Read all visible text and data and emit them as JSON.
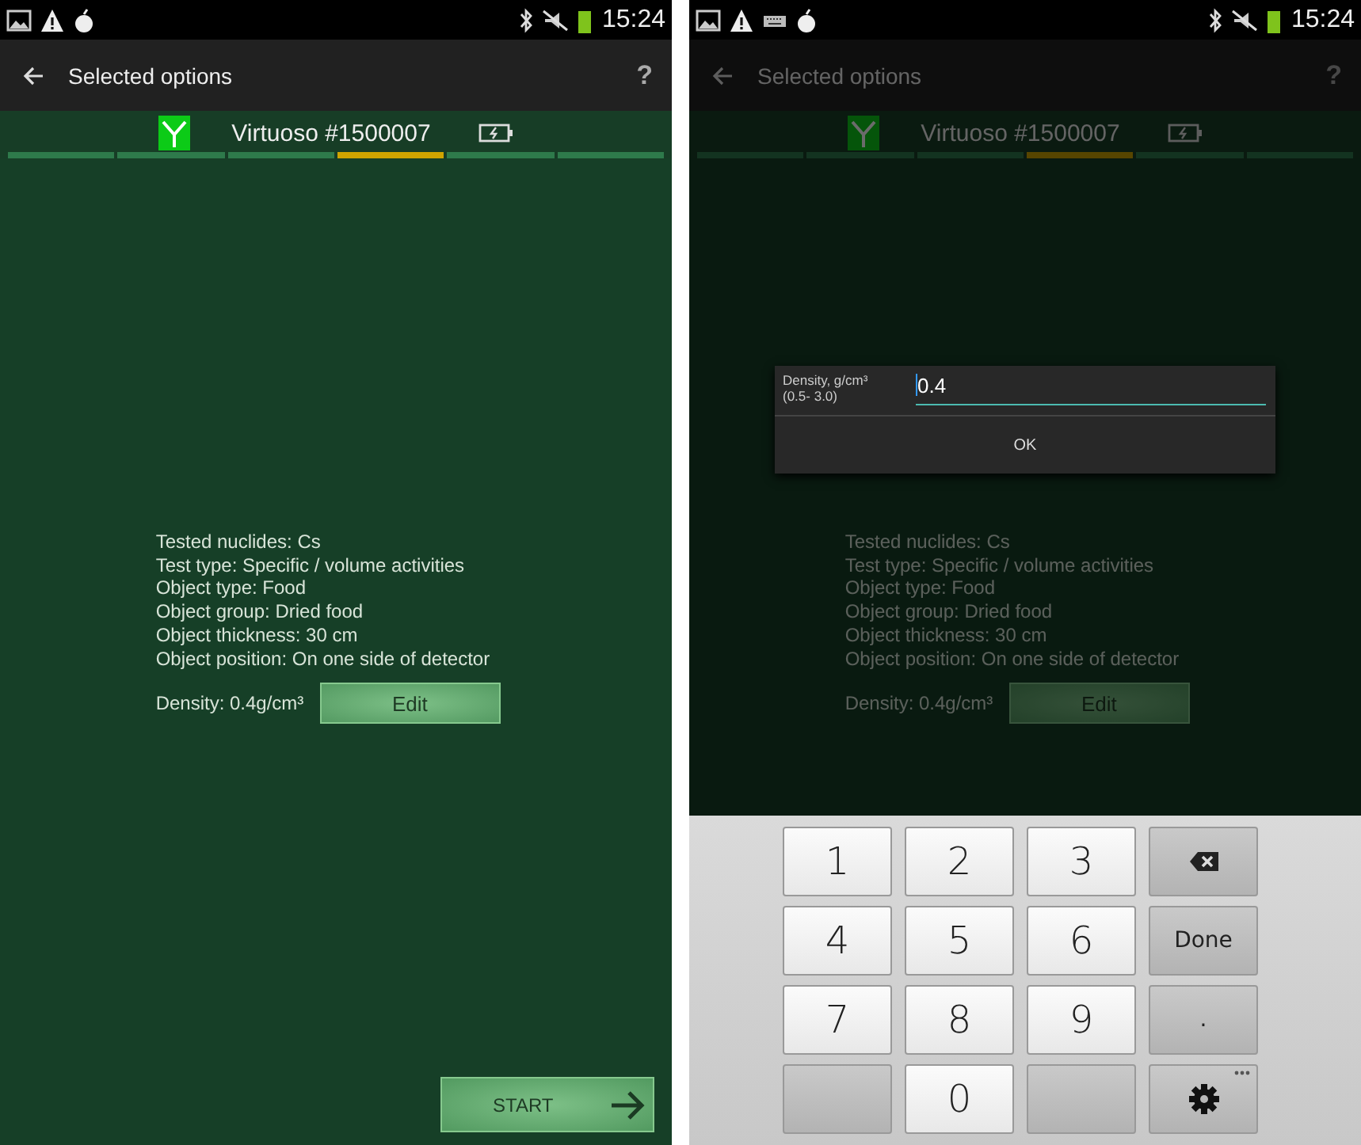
{
  "screens": [
    {
      "dimmed": false,
      "status_bar": {
        "icons": [
          {
            "kind": "image"
          },
          {
            "kind": "warning"
          },
          {
            "kind": "apple"
          }
        ],
        "time": "15:24"
      },
      "title": "Selected options",
      "help": "?",
      "device": "Virtuoso #1500007",
      "segments": [
        {
          "selected": false
        },
        {
          "selected": false
        },
        {
          "selected": false
        },
        {
          "selected": true
        },
        {
          "selected": false
        },
        {
          "selected": false
        }
      ],
      "options": [
        "Tested nuclides: Cs",
        "Test type: Specific / volume activities",
        "Object type: Food",
        "Object group: Dried food",
        "Object thickness: 30 cm",
        "Object position: On one side of detector"
      ],
      "density": "Density: 0.4g/cm³",
      "edit_button": "Edit",
      "start_button": "START"
    },
    {
      "dimmed": true,
      "status_bar": {
        "icons": [
          {
            "kind": "image"
          },
          {
            "kind": "warning"
          },
          {
            "kind": "keyboard"
          },
          {
            "kind": "apple"
          }
        ],
        "time": "15:24"
      },
      "title": "Selected options",
      "help": "?",
      "device": "Virtuoso #1500007",
      "segments": [
        {
          "selected": false
        },
        {
          "selected": false
        },
        {
          "selected": false
        },
        {
          "selected": true
        },
        {
          "selected": false
        },
        {
          "selected": false
        }
      ],
      "options": [
        "Tested nuclides: Cs",
        "Test type: Specific / volume activities",
        "Object type: Food",
        "Object group: Dried food",
        "Object thickness: 30 cm",
        "Object position: On one side of detector"
      ],
      "density": "Density: 0.4g/cm³",
      "edit_button": "Edit",
      "dialog": {
        "label_lines": [
          "Density, g/cm³",
          "(0.5- 3.0)"
        ],
        "value": "0.4",
        "ok_button": "OK"
      },
      "keyboard": [
        {
          "kind": "digit",
          "label": "1"
        },
        {
          "kind": "digit",
          "label": "2"
        },
        {
          "kind": "digit",
          "label": "3"
        },
        {
          "kind": "backspace"
        },
        {
          "kind": "digit",
          "label": "4"
        },
        {
          "kind": "digit",
          "label": "5"
        },
        {
          "kind": "digit",
          "label": "6"
        },
        {
          "kind": "action",
          "label": "Done"
        },
        {
          "kind": "digit",
          "label": "7"
        },
        {
          "kind": "digit",
          "label": "8"
        },
        {
          "kind": "digit",
          "label": "9"
        },
        {
          "kind": "action",
          "label": "."
        },
        {
          "kind": "blank"
        },
        {
          "kind": "digit",
          "label": "0"
        },
        {
          "kind": "blank"
        },
        {
          "kind": "settings"
        }
      ]
    }
  ]
}
